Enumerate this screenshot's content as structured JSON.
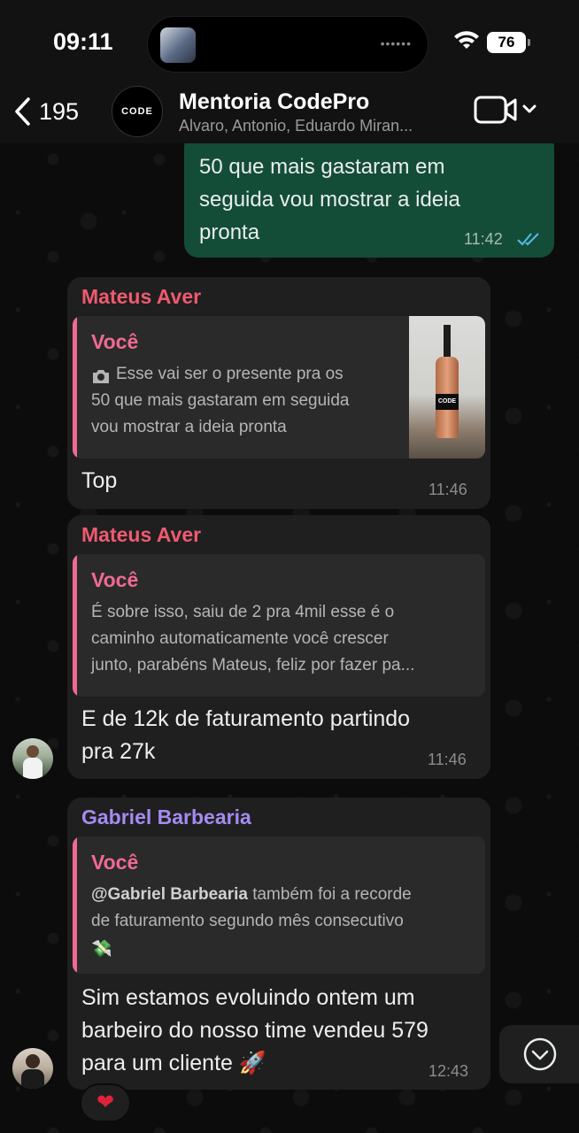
{
  "status_bar": {
    "time": "09:11",
    "battery": "76"
  },
  "header": {
    "back_count": "195",
    "group_avatar_text": "CODE",
    "title": "Mentoria CodePro",
    "subtitle": "Alvaro, Antonio, Eduardo Miran..."
  },
  "messages": [
    {
      "type": "outgoing",
      "lines": [
        "50 que mais gastaram em",
        "seguida vou mostrar a ideia",
        "pronta"
      ],
      "time": "11:42",
      "read_color": "#53bdeb"
    },
    {
      "type": "incoming",
      "sender": "Mateus Aver",
      "sender_color": "#ee5a6f",
      "quote": {
        "author": "Você",
        "lines": [
          "Esse vai ser o presente pra os",
          "50 que mais gastaram em seguida",
          "vou mostrar a ideia pronta"
        ],
        "thumbnail_label": "CODE"
      },
      "text": "Top",
      "time": "11:46"
    },
    {
      "type": "incoming",
      "sender": "Mateus Aver",
      "sender_color": "#ee5a6f",
      "quote": {
        "author": "Você",
        "lines": [
          "É sobre isso, saiu de 2 pra 4mil esse é o",
          "caminho automaticamente você crescer",
          "junto, parabéns Mateus, feliz por fazer pa..."
        ]
      },
      "lines": [
        "E de 12k de faturamento partindo",
        "pra 27k"
      ],
      "time": "11:46"
    },
    {
      "type": "incoming",
      "sender": "Gabriel Barbearia",
      "sender_color": "#a48bf0",
      "quote": {
        "author": "Você",
        "mention": "@Gabriel Barbearia",
        "line1_rest": " também foi a recorde",
        "line2": "de faturamento segundo mês consecutivo",
        "line3": "💸"
      },
      "lines": [
        "Sim estamos evoluindo ontem um",
        "barbeiro do nosso time vendeu 579",
        "para um cliente 🚀"
      ],
      "time": "12:43",
      "reaction": "❤"
    }
  ]
}
